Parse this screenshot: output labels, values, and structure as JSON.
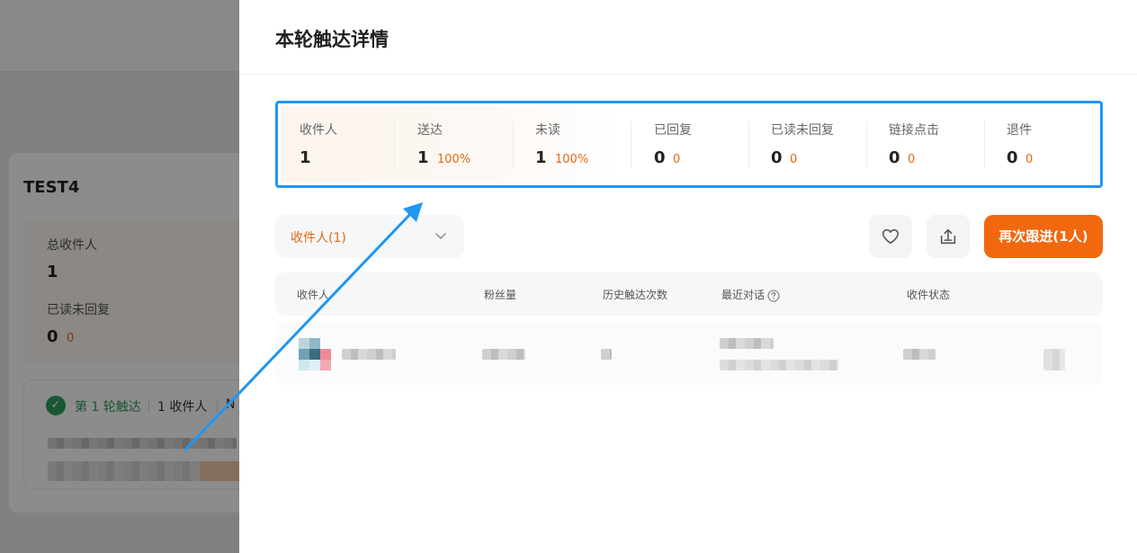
{
  "background": {
    "card_title": "TEST4",
    "total_recipients_label": "总收件人",
    "total_recipients_value": "1",
    "read_unreplied_label": "已读未回复",
    "read_unreplied_value": "0",
    "read_unreplied_pct": "0",
    "round_label": "第 1 轮触达",
    "round_recipients": "1 收件人",
    "round_next": "N"
  },
  "drawer": {
    "title": "本轮触达详情",
    "stats": [
      {
        "label": "收件人",
        "value": "1",
        "pct": ""
      },
      {
        "label": "送达",
        "value": "1",
        "pct": "100%"
      },
      {
        "label": "未读",
        "value": "1",
        "pct": "100%"
      },
      {
        "label": "已回复",
        "value": "0",
        "pct": "0"
      },
      {
        "label": "已读未回复",
        "value": "0",
        "pct": "0"
      },
      {
        "label": "链接点击",
        "value": "0",
        "pct": "0"
      },
      {
        "label": "退件",
        "value": "0",
        "pct": "0"
      }
    ],
    "filter": {
      "selected": "收件人(1)"
    },
    "actions": {
      "follow_up_label": "再次跟进(1人)"
    },
    "table": {
      "columns": [
        "收件人",
        "粉丝量",
        "历史触达次数",
        "最近对话",
        "收件状态"
      ]
    }
  },
  "colors": {
    "accent_orange": "#f2680f",
    "pct_orange": "#e06a17",
    "highlight_blue": "#2196f3",
    "success_green": "#2f9e5b"
  },
  "icons": {
    "favorite": "heart-icon",
    "export": "export-icon",
    "dropdown": "chevron-down-icon",
    "help": "help-circle-icon",
    "done": "check-circle-icon"
  }
}
